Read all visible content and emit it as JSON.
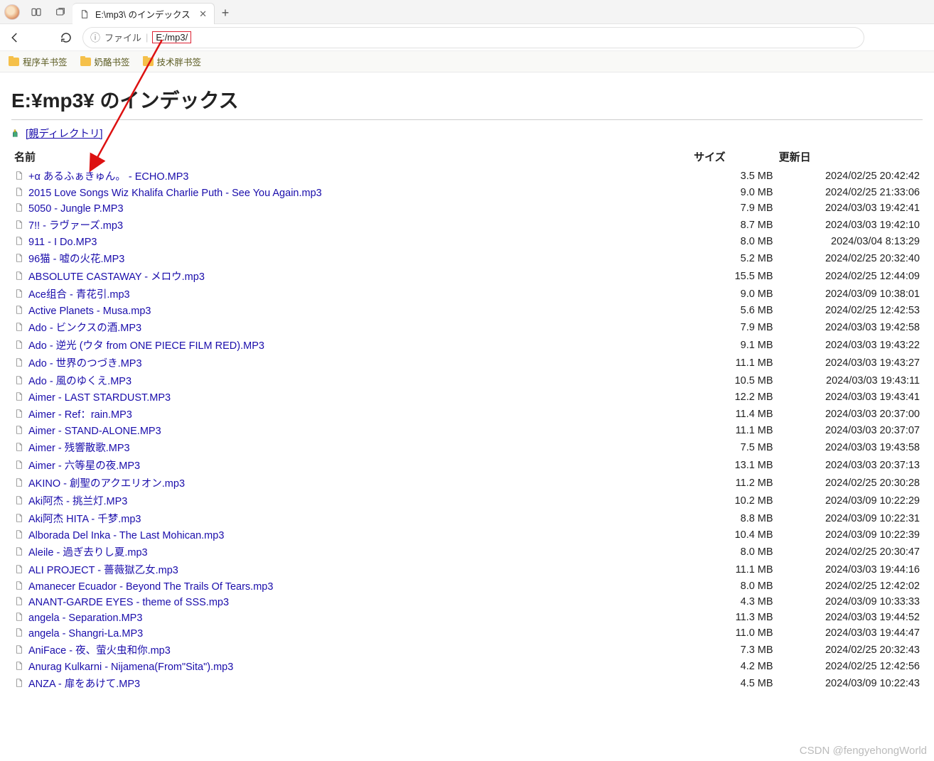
{
  "tab": {
    "title": "E:\\mp3\\ のインデックス"
  },
  "address": {
    "protocol_label": "ファイル",
    "url": "E:/mp3/"
  },
  "bookmarks": [
    {
      "label": "程序羊书签"
    },
    {
      "label": "奶酪书签"
    },
    {
      "label": "技术胖书签"
    }
  ],
  "page": {
    "title": "E:¥mp3¥ のインデックス",
    "parent_label": "[親ディレクトリ]"
  },
  "columns": {
    "name": "名前",
    "size": "サイズ",
    "date": "更新日"
  },
  "files": [
    {
      "name": "+α あるふぁきゅん。 - ECHO.MP3",
      "size": "3.5 MB",
      "date": "2024/02/25 20:42:42"
    },
    {
      "name": "2015 Love Songs Wiz Khalifa Charlie Puth - See You Again.mp3",
      "size": "9.0 MB",
      "date": "2024/02/25 21:33:06"
    },
    {
      "name": "5050 - Jungle P.MP3",
      "size": "7.9 MB",
      "date": "2024/03/03 19:42:41"
    },
    {
      "name": "7!! - ラヴァーズ.mp3",
      "size": "8.7 MB",
      "date": "2024/03/03 19:42:10"
    },
    {
      "name": "911 - I Do.MP3",
      "size": "8.0 MB",
      "date": "2024/03/04 8:13:29"
    },
    {
      "name": "96猫 - 嘘の火花.MP3",
      "size": "5.2 MB",
      "date": "2024/02/25 20:32:40"
    },
    {
      "name": "ABSOLUTE CASTAWAY - メロウ.mp3",
      "size": "15.5 MB",
      "date": "2024/02/25 12:44:09"
    },
    {
      "name": "Ace组合 - 青花引.mp3",
      "size": "9.0 MB",
      "date": "2024/03/09 10:38:01"
    },
    {
      "name": "Active Planets - Musa.mp3",
      "size": "5.6 MB",
      "date": "2024/02/25 12:42:53"
    },
    {
      "name": "Ado - ビンクスの酒.MP3",
      "size": "7.9 MB",
      "date": "2024/03/03 19:42:58"
    },
    {
      "name": "Ado - 逆光 (ウタ from ONE PIECE FILM RED).MP3",
      "size": "9.1 MB",
      "date": "2024/03/03 19:43:22"
    },
    {
      "name": "Ado - 世界のつづき.MP3",
      "size": "11.1 MB",
      "date": "2024/03/03 19:43:27"
    },
    {
      "name": "Ado - 風のゆくえ.MP3",
      "size": "10.5 MB",
      "date": "2024/03/03 19:43:11"
    },
    {
      "name": "Aimer - LAST STARDUST.MP3",
      "size": "12.2 MB",
      "date": "2024/03/03 19:43:41"
    },
    {
      "name": "Aimer - Ref：rain.MP3",
      "size": "11.4 MB",
      "date": "2024/03/03 20:37:00"
    },
    {
      "name": "Aimer - STAND-ALONE.MP3",
      "size": "11.1 MB",
      "date": "2024/03/03 20:37:07"
    },
    {
      "name": "Aimer - 残響散歌.MP3",
      "size": "7.5 MB",
      "date": "2024/03/03 19:43:58"
    },
    {
      "name": "Aimer - 六等星の夜.MP3",
      "size": "13.1 MB",
      "date": "2024/03/03 20:37:13"
    },
    {
      "name": "AKINO - 創聖のアクエリオン.mp3",
      "size": "11.2 MB",
      "date": "2024/02/25 20:30:28"
    },
    {
      "name": "Aki阿杰 - 挑兰灯.MP3",
      "size": "10.2 MB",
      "date": "2024/03/09 10:22:29"
    },
    {
      "name": "Aki阿杰 HITA - 千梦.mp3",
      "size": "8.8 MB",
      "date": "2024/03/09 10:22:31"
    },
    {
      "name": "Alborada Del Inka - The Last Mohican.mp3",
      "size": "10.4 MB",
      "date": "2024/03/09 10:22:39"
    },
    {
      "name": "Aleile - 過ぎ去りし夏.mp3",
      "size": "8.0 MB",
      "date": "2024/02/25 20:30:47"
    },
    {
      "name": "ALI PROJECT - 薔薇獄乙女.mp3",
      "size": "11.1 MB",
      "date": "2024/03/03 19:44:16"
    },
    {
      "name": "Amanecer Ecuador - Beyond The Trails Of Tears.mp3",
      "size": "8.0 MB",
      "date": "2024/02/25 12:42:02"
    },
    {
      "name": "ANANT-GARDE EYES - theme of SSS.mp3",
      "size": "4.3 MB",
      "date": "2024/03/09 10:33:33"
    },
    {
      "name": "angela - Separation.MP3",
      "size": "11.3 MB",
      "date": "2024/03/03 19:44:52"
    },
    {
      "name": "angela - Shangri-La.MP3",
      "size": "11.0 MB",
      "date": "2024/03/03 19:44:47"
    },
    {
      "name": "AniFace - 夜、萤火虫和你.mp3",
      "size": "7.3 MB",
      "date": "2024/02/25 20:32:43"
    },
    {
      "name": "Anurag Kulkarni - Nijamena(From\"Sita\").mp3",
      "size": "4.2 MB",
      "date": "2024/02/25 12:42:56"
    },
    {
      "name": "ANZA - 扉をあけて.MP3",
      "size": "4.5 MB",
      "date": "2024/03/09 10:22:43"
    }
  ],
  "watermark": "CSDN @fengyehongWorld"
}
